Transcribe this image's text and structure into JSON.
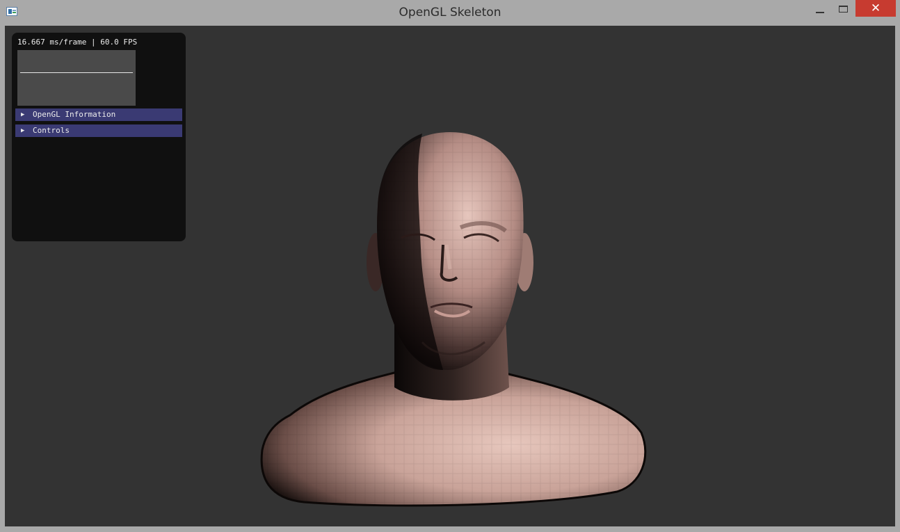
{
  "window": {
    "title": "OpenGL Skeleton",
    "close_glyph": "✕",
    "icons": [
      "app-icon",
      "minimize-icon",
      "maximize-icon",
      "close-icon"
    ]
  },
  "overlay": {
    "fps_text": "16.667 ms/frame | 60.0 FPS",
    "headers": [
      {
        "label": "OpenGL Information",
        "arrow": "▶"
      },
      {
        "label": "Controls",
        "arrow": "▶"
      }
    ]
  },
  "colors": {
    "viewport_bg": "#333333",
    "panel_bg": "#101010",
    "header_bg": "#3a3a73",
    "close_button": "#c73b30"
  }
}
